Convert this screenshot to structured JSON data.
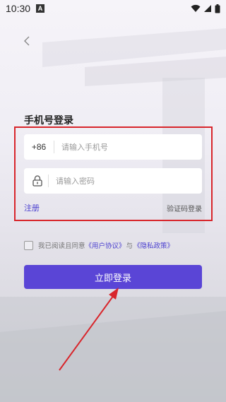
{
  "status_bar": {
    "time": "10:30",
    "badge": "A"
  },
  "page": {
    "title": "手机号登录"
  },
  "phone_field": {
    "prefix": "+86",
    "placeholder": "请输入手机号"
  },
  "password_field": {
    "placeholder": "请输入密码"
  },
  "links": {
    "register": "注册",
    "code_login": "验证码登录"
  },
  "agreement": {
    "prefix": "我已阅读且同意",
    "user_agreement": "《用户协议》",
    "conjunction": "与",
    "privacy_policy": "《隐私政策》"
  },
  "login_button": {
    "label": "立即登录"
  },
  "colors": {
    "accent": "#5a45d6",
    "link": "#4a3fcf",
    "highlight": "#d8252b"
  }
}
